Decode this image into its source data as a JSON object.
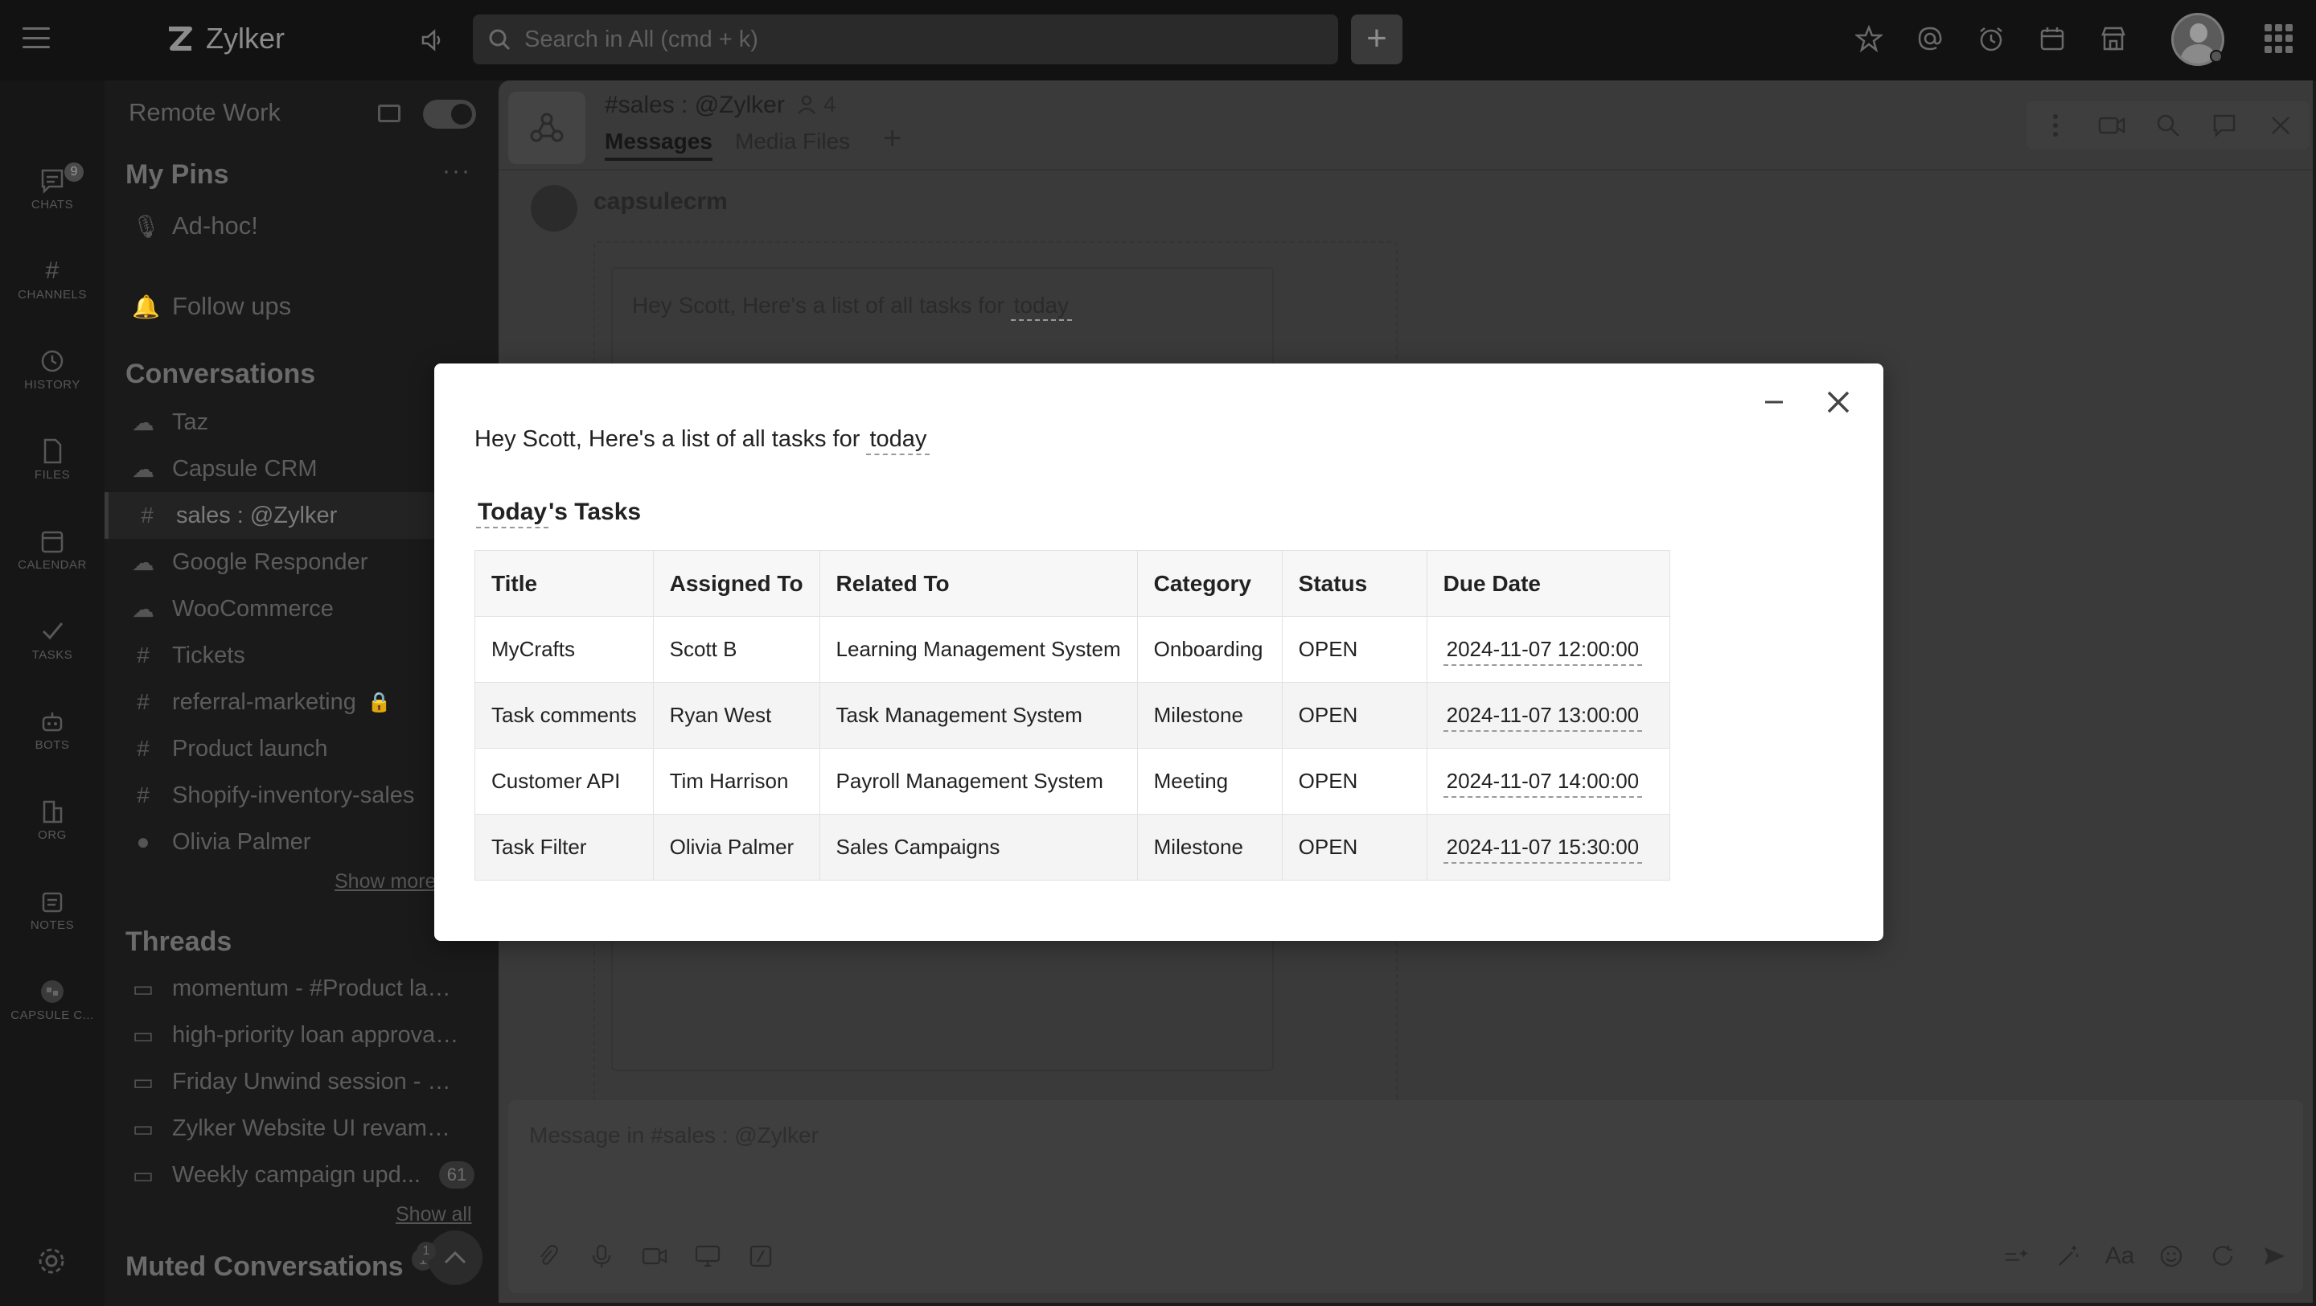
{
  "app": {
    "brand": "Zylker",
    "search_placeholder": "Search in All (cmd + k)"
  },
  "rail": {
    "items": [
      {
        "label": "CHATS",
        "icon": "chat-icon",
        "badge": "9"
      },
      {
        "label": "CHANNELS",
        "icon": "hash-icon"
      },
      {
        "label": "HISTORY",
        "icon": "history-icon"
      },
      {
        "label": "FILES",
        "icon": "file-icon"
      },
      {
        "label": "CALENDAR",
        "icon": "calendar-icon"
      },
      {
        "label": "TASKS",
        "icon": "check-icon"
      },
      {
        "label": "BOTS",
        "icon": "bot-icon"
      },
      {
        "label": "ORG",
        "icon": "org-icon"
      },
      {
        "label": "NOTES",
        "icon": "notes-icon"
      },
      {
        "label": "CAPSULE C...",
        "icon": "capsule-icon"
      }
    ]
  },
  "sidebar": {
    "workspace": "Remote Work",
    "pins_title": "My Pins",
    "pins": [
      "Ad-hoc!",
      "Follow ups"
    ],
    "conversations_title": "Conversations",
    "conversations": [
      {
        "label": "Taz",
        "icon": "bot-icon"
      },
      {
        "label": "Capsule CRM",
        "icon": "bot-icon"
      },
      {
        "label": "sales : @Zylker",
        "icon": "hash-icon",
        "active": true
      },
      {
        "label": "Google Responder",
        "icon": "bot-icon"
      },
      {
        "label": "WooCommerce",
        "icon": "bot-icon"
      },
      {
        "label": "Tickets",
        "icon": "hash-icon"
      },
      {
        "label": "referral-marketing",
        "icon": "hash-icon",
        "locked": true
      },
      {
        "label": "Product launch",
        "icon": "hash-icon"
      },
      {
        "label": "Shopify-inventory-sales",
        "icon": "hash-icon"
      },
      {
        "label": "Olivia Palmer",
        "icon": "user-dot-icon"
      }
    ],
    "show_more": "Show more",
    "threads_title": "Threads",
    "threads": [
      {
        "label": "momentum - #Product laun..."
      },
      {
        "label": "high-priority loan approvals..."
      },
      {
        "label": "Friday Unwind session - #Z..."
      },
      {
        "label": "Zylker Website UI revamp - ..."
      },
      {
        "label": "Weekly campaign upd...",
        "badge": "61"
      }
    ],
    "show_all": "Show all",
    "muted_title": "Muted Conversations",
    "muted_badge": "1",
    "muted_count": "1"
  },
  "channel": {
    "name": "#sales : @Zylker",
    "members": "4",
    "tabs": [
      "Messages",
      "Media Files"
    ],
    "sender": "capsulecrm",
    "preview_text_before": "Hey Scott, Here's a list of all tasks for",
    "preview_today": "today",
    "composer_placeholder": "Message in #sales : @Zylker",
    "font_btn": "Aa"
  },
  "modal": {
    "intro_before": "Hey Scott, Here's a list of all tasks for",
    "intro_today": "today",
    "subtitle_today": "Today",
    "subtitle_rest": "'s Tasks",
    "columns": [
      "Title",
      "Assigned To",
      "Related To",
      "Category",
      "Status",
      "Due Date"
    ],
    "rows": [
      [
        "MyCrafts",
        "Scott B",
        "Learning Management System",
        "Onboarding",
        "OPEN",
        "2024-11-07 12:00:00"
      ],
      [
        "Task comments",
        "Ryan West",
        "Task Management System",
        "Milestone",
        "OPEN",
        "2024-11-07 13:00:00"
      ],
      [
        "Customer API",
        "Tim Harrison",
        "Payroll Management System",
        "Meeting",
        "OPEN",
        "2024-11-07 14:00:00"
      ],
      [
        "Task Filter",
        "Olivia Palmer",
        "Sales Campaigns",
        "Milestone",
        "OPEN",
        "2024-11-07 15:30:00"
      ]
    ]
  }
}
